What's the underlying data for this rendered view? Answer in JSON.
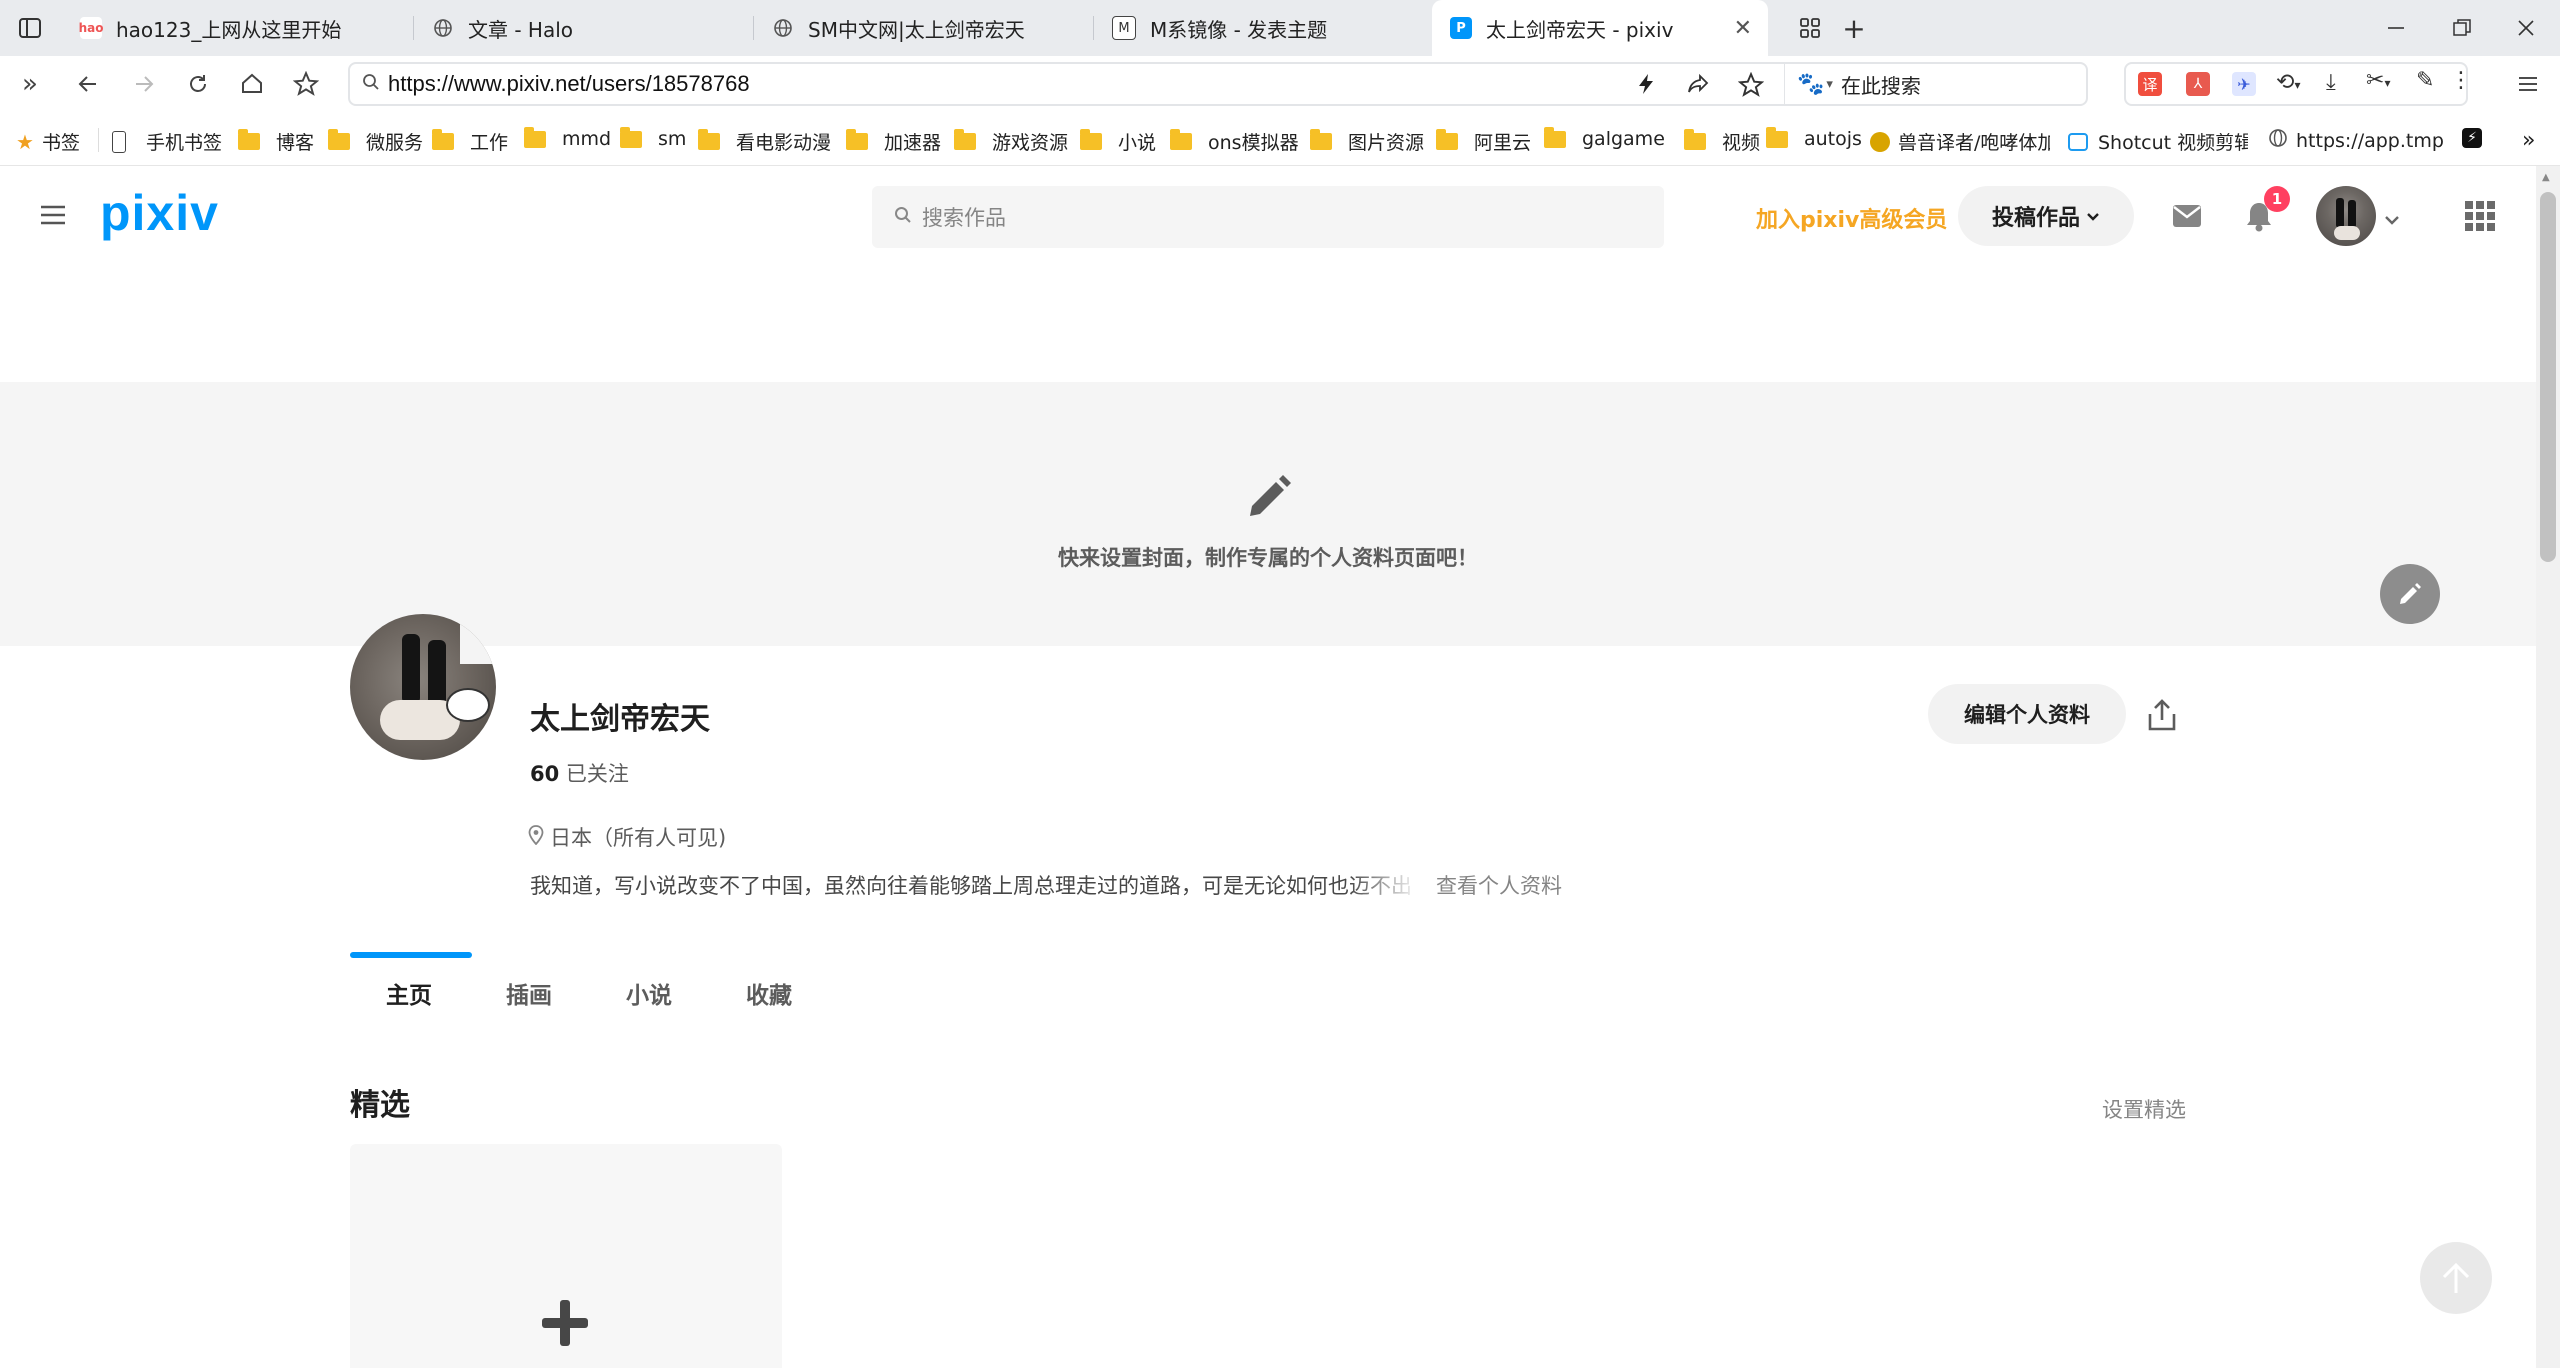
{
  "browser": {
    "tabs": [
      {
        "title": "hao123_上网从这里开始",
        "icon": "hao123-icon"
      },
      {
        "title": "文章 - Halo",
        "icon": "globe-icon"
      },
      {
        "title": "SM中文网|太上剑帝宏天",
        "icon": "globe-icon"
      },
      {
        "title": "M系镜像 - 发表主题",
        "icon": "m-icon"
      },
      {
        "title": "太上剑帝宏天 - pixiv",
        "icon": "pixiv-icon"
      }
    ],
    "url": "https://www.pixiv.net/users/18578768",
    "search_placeholder": "在此搜索",
    "bookmarks": [
      "书签",
      "手机书签",
      "博客",
      "微服务",
      "工作",
      "mmd",
      "sm",
      "看电影动漫",
      "加速器",
      "游戏资源",
      "小说",
      "ons模拟器",
      "图片资源",
      "阿里云",
      "galgame",
      "视频",
      "autojs",
      "兽音译者/咆哮体加",
      "Shotcut 视频剪辑",
      "https://app.tmp.l"
    ]
  },
  "pixiv": {
    "logo": "pixiv",
    "search_placeholder": "搜索作品",
    "premium_link": "加入pixiv高级会员",
    "submit_button": "投稿作品",
    "notification_count": "1"
  },
  "profile": {
    "cover_prompt": "快来设置封面，制作专属的个人资料页面吧！",
    "username": "太上剑帝宏天",
    "following_count": "60",
    "following_label": "已关注",
    "location": "日本（所有人可见)",
    "bio": "我知道，写小说改变不了中国，虽然向往着能够踏上周总理走过的道路，可是无论如何也迈不出",
    "view_profile_link": "查看个人资料",
    "edit_profile_button": "编辑个人资料",
    "tabs": [
      "主页",
      "插画",
      "小说",
      "收藏"
    ],
    "featured_title": "精选",
    "set_featured_link": "设置精选"
  },
  "colors": {
    "pixiv_blue": "#0096fa",
    "premium_orange": "#f5a623",
    "badge_red": "#ff4060"
  }
}
